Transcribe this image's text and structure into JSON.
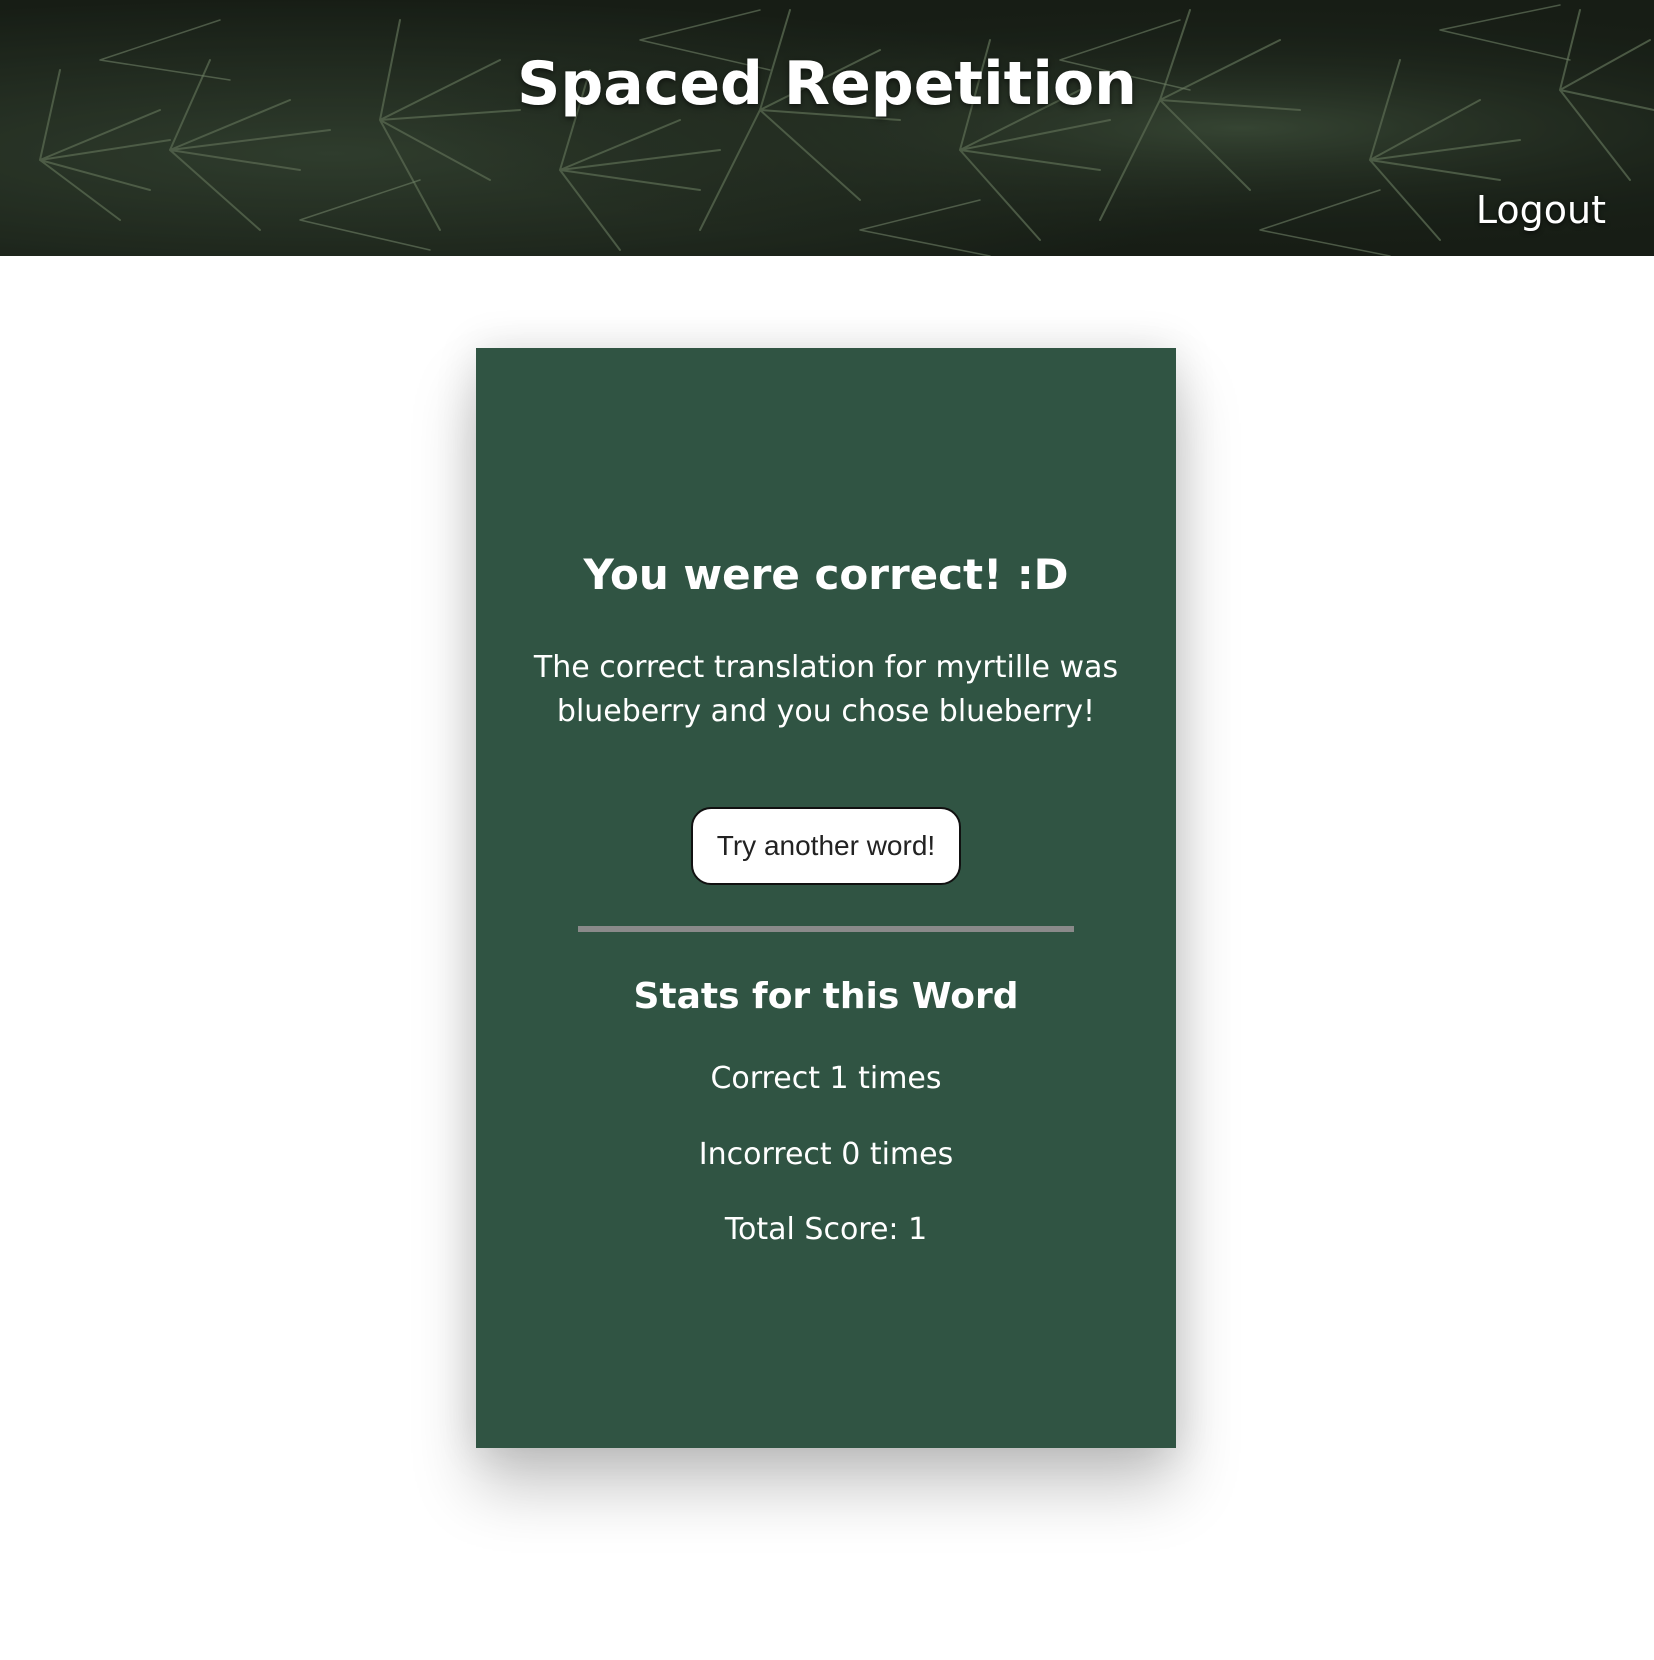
{
  "header": {
    "title": "Spaced Repetition",
    "logout_label": "Logout",
    "background_image": "pine-branches-photo"
  },
  "card": {
    "heading": "You were correct! :D",
    "feedback": "The correct translation for myrtille was blueberry and you chose blueberry!",
    "button_label": "Try another word!",
    "stats_heading": "Stats for this Word",
    "correct_text": "Correct 1 times",
    "incorrect_text": "Incorrect 0 times",
    "total_text": "Total Score: 1"
  },
  "colors": {
    "card_background": "#305443",
    "divider": "#8a8a8a",
    "text": "#ffffff",
    "page_background": "#ffffff"
  }
}
